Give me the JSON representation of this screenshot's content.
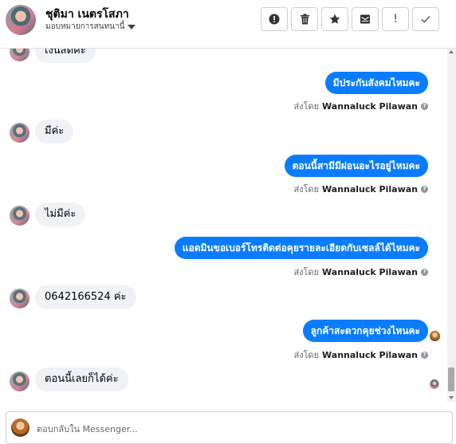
{
  "header": {
    "name": "ชุติมา เนตรโสภา",
    "subtitle": "มอบหมายการสนทนานี้",
    "actions": [
      {
        "id": "spam",
        "icon": "alert-circle-icon",
        "glyph": "❗"
      },
      {
        "id": "delete",
        "icon": "trash-icon",
        "glyph": "🗑"
      },
      {
        "id": "star",
        "icon": "star-icon",
        "glyph": "★"
      },
      {
        "id": "mark-unread",
        "icon": "envelope-icon",
        "glyph": "✉"
      },
      {
        "id": "follow-up",
        "icon": "exclamation-icon",
        "glyph": "!"
      },
      {
        "id": "done",
        "icon": "check-icon",
        "glyph": "✓"
      }
    ]
  },
  "thread": {
    "messages": [
      {
        "direction": "in",
        "text": "เงินสดคะ"
      },
      {
        "direction": "out",
        "text": "มีประกันสังคมไหมคะ",
        "sent_by_label": "ส่งโดย",
        "sender": "Wannaluck Pilawan"
      },
      {
        "direction": "in",
        "text": "มีค่ะ"
      },
      {
        "direction": "out",
        "text": "ตอนนี้สามีมีผ่อนอะไรอยู่ไหมคะ",
        "sent_by_label": "ส่งโดย",
        "sender": "Wannaluck Pilawan"
      },
      {
        "direction": "in",
        "text": "ไม่มีค่ะ"
      },
      {
        "direction": "out",
        "text": "แอดมินขอเบอร์โทรติดต่อคุยรายละเอียดกับเซลล์ได้ไหมคะ",
        "sent_by_label": "ส่งโดย",
        "sender": "Wannaluck Pilawan"
      },
      {
        "direction": "in",
        "text": "0642166524 ค่ะ"
      },
      {
        "direction": "out",
        "text": "ลูกค้าสะดวกคุยช่วงไหนคะ",
        "sent_by_label": "ส่งโดย",
        "sender": "Wannaluck Pilawan"
      },
      {
        "direction": "in",
        "text": "ตอนนี้เลยก็ได้ค่ะ"
      }
    ]
  },
  "composer": {
    "placeholder": "ตอบกลับใน Messenger..."
  },
  "colors": {
    "outgoing_bubble": "#0a7cff",
    "incoming_bubble": "#f0f2f5"
  }
}
